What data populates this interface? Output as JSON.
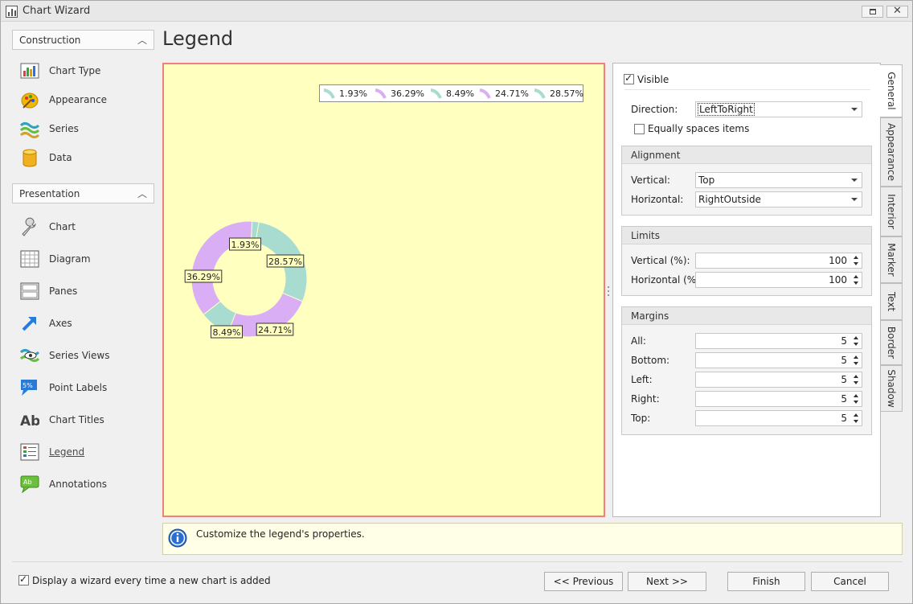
{
  "window": {
    "title": "Chart Wizard"
  },
  "nav": {
    "construction": {
      "header": "Construction",
      "items": [
        {
          "label": "Chart Type",
          "icon": "chart-type-icon"
        },
        {
          "label": "Appearance",
          "icon": "appearance-icon"
        },
        {
          "label": "Series",
          "icon": "series-icon"
        },
        {
          "label": "Data",
          "icon": "data-icon"
        }
      ]
    },
    "presentation": {
      "header": "Presentation",
      "items": [
        {
          "label": "Chart",
          "icon": "wrench-icon"
        },
        {
          "label": "Diagram",
          "icon": "diagram-icon"
        },
        {
          "label": "Panes",
          "icon": "panes-icon"
        },
        {
          "label": "Axes",
          "icon": "axes-icon"
        },
        {
          "label": "Series Views",
          "icon": "series-views-icon"
        },
        {
          "label": "Point Labels",
          "icon": "point-labels-icon"
        },
        {
          "label": "Chart Titles",
          "icon": "chart-titles-icon"
        },
        {
          "label": "Legend",
          "icon": "legend-icon"
        },
        {
          "label": "Annotations",
          "icon": "annotations-icon"
        }
      ]
    }
  },
  "page": {
    "title": "Legend"
  },
  "chart_data": {
    "type": "pie",
    "variant": "doughnut",
    "legend_position": "top-right",
    "slices": [
      {
        "label": "1.93%",
        "value": 1.93,
        "color": "#a8dcd1"
      },
      {
        "label": "28.57%",
        "value": 28.57,
        "color": "#a8dcd1"
      },
      {
        "label": "24.71%",
        "value": 24.71,
        "color": "#d9aef5"
      },
      {
        "label": "8.49%",
        "value": 8.49,
        "color": "#a8dcd1"
      },
      {
        "label": "36.29%",
        "value": 36.29,
        "color": "#d9aef5"
      }
    ],
    "legend": [
      "1.93%",
      "36.29%",
      "8.49%",
      "24.71%",
      "28.57%"
    ],
    "legend_colors": [
      "#a8dcd1",
      "#d9aef5",
      "#a8dcd1",
      "#d9aef5",
      "#a8dcd1"
    ]
  },
  "props": {
    "visible_label": "Visible",
    "visible_checked": true,
    "direction_label": "Direction:",
    "direction_value": "LeftToRight",
    "equally_label": "Equally spaces items",
    "equally_checked": false,
    "alignment": {
      "header": "Alignment",
      "vertical_label": "Vertical:",
      "vertical_value": "Top",
      "horizontal_label": "Horizontal:",
      "horizontal_value": "RightOutside"
    },
    "limits": {
      "header": "Limits",
      "vertical_label": "Vertical (%):",
      "vertical_value": "100",
      "horizontal_label": "Horizontal (%)",
      "horizontal_value": "100"
    },
    "margins": {
      "header": "Margins",
      "all_label": "All:",
      "all_value": "5",
      "bottom_label": "Bottom:",
      "bottom_value": "5",
      "left_label": "Left:",
      "left_value": "5",
      "right_label": "Right:",
      "right_value": "5",
      "top_label": "Top:",
      "top_value": "5"
    }
  },
  "tabs": [
    "General",
    "Appearance",
    "Interior",
    "Marker",
    "Text",
    "Border",
    "Shadow"
  ],
  "info": {
    "text": "Customize the legend's properties."
  },
  "footer": {
    "checkbox_label": "Display a wizard every time a new chart is added",
    "checkbox_checked": true,
    "previous": "<< Previous",
    "next": "Next >>",
    "finish": "Finish",
    "cancel": "Cancel"
  }
}
